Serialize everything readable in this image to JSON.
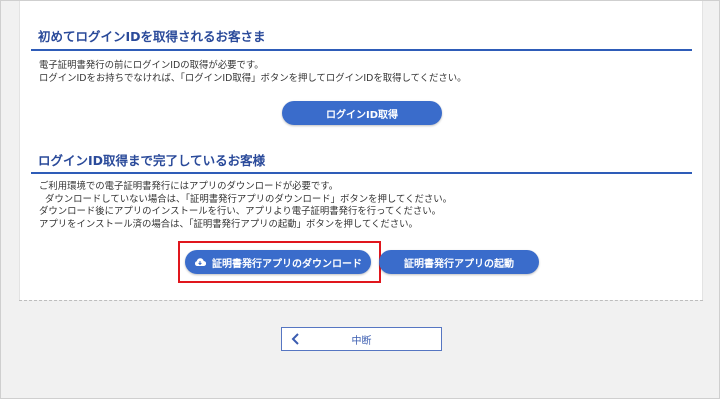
{
  "section1": {
    "title": "初めてログインIDを取得されるお客さま",
    "lines": [
      "電子証明書発行の前にログインIDの取得が必要です。",
      "ログインIDをお持ちでなければ、「ログインID取得」ボタンを押してログインIDを取得してください。"
    ],
    "button_label": "ログインID取得"
  },
  "section2": {
    "title": "ログインID取得まで完了しているお客様",
    "lines": [
      "ご利用環境での電子証明書発行にはアプリのダウンロードが必要です。",
      "ダウンロードしていない場合は、「証明書発行アプリのダウンロード」ボタンを押してください。",
      "ダウンロード後にアプリのインストールを行い、アプリより電子証明書発行を行ってください。",
      "アプリをインストール済の場合は、「証明書発行アプリの起動」ボタンを押してください。"
    ],
    "download_label": "証明書発行アプリのダウンロード",
    "launch_label": "証明書発行アプリの起動"
  },
  "footer": {
    "back_label": "中断"
  },
  "icons": {
    "download": "cloud-download-icon",
    "back": "chevron-left-icon"
  },
  "colors": {
    "accent": "#3a6ccb",
    "title": "#2a4a9a",
    "highlight": "#e0161d"
  }
}
